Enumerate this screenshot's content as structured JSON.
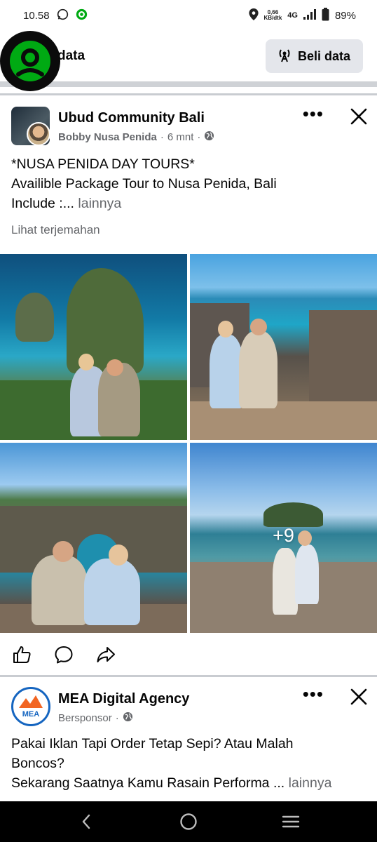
{
  "status_bar": {
    "time": "10.58",
    "net_speed_value": "0,66",
    "net_speed_unit": "KB/dtk",
    "network": "4G",
    "battery": "89%"
  },
  "data_header": {
    "title": "data",
    "buy_button": "Beli data"
  },
  "post": {
    "page_name": "Ubud Community Bali",
    "author": "Bobby Nusa Penida",
    "time": "6 mnt",
    "text_line1": "*NUSA PENIDA DAY TOURS*",
    "text_line2": "Availible Package Tour to Nusa Penida, Bali",
    "text_line3": "Include :...",
    "more": "lainnya",
    "translate": "Lihat terjemahan",
    "more_photos": "+9"
  },
  "ad": {
    "name": "MEA Digital Agency",
    "label": "Bersponsor",
    "logo_text": "MEA",
    "text_line1": "Pakai Iklan Tapi Order Tetap Sepi? Atau Malah",
    "text_line2": "Boncos?",
    "text_line3": "Sekarang Saatnya Kamu Rasain Performa ...",
    "more": "lainnya"
  },
  "colors": {
    "brand_green": "#00aa13",
    "secondary_text": "#65676b",
    "button_bg": "#e4e6eb",
    "ad_ring": "#1565c0"
  },
  "icons": [
    "whatsapp-icon",
    "gojek-icon",
    "location-icon",
    "signal-icon",
    "battery-icon",
    "antenna-icon",
    "globe-icon",
    "more-icon",
    "close-icon",
    "like-icon",
    "comment-icon",
    "share-icon",
    "back-icon",
    "home-icon",
    "recents-icon"
  ]
}
